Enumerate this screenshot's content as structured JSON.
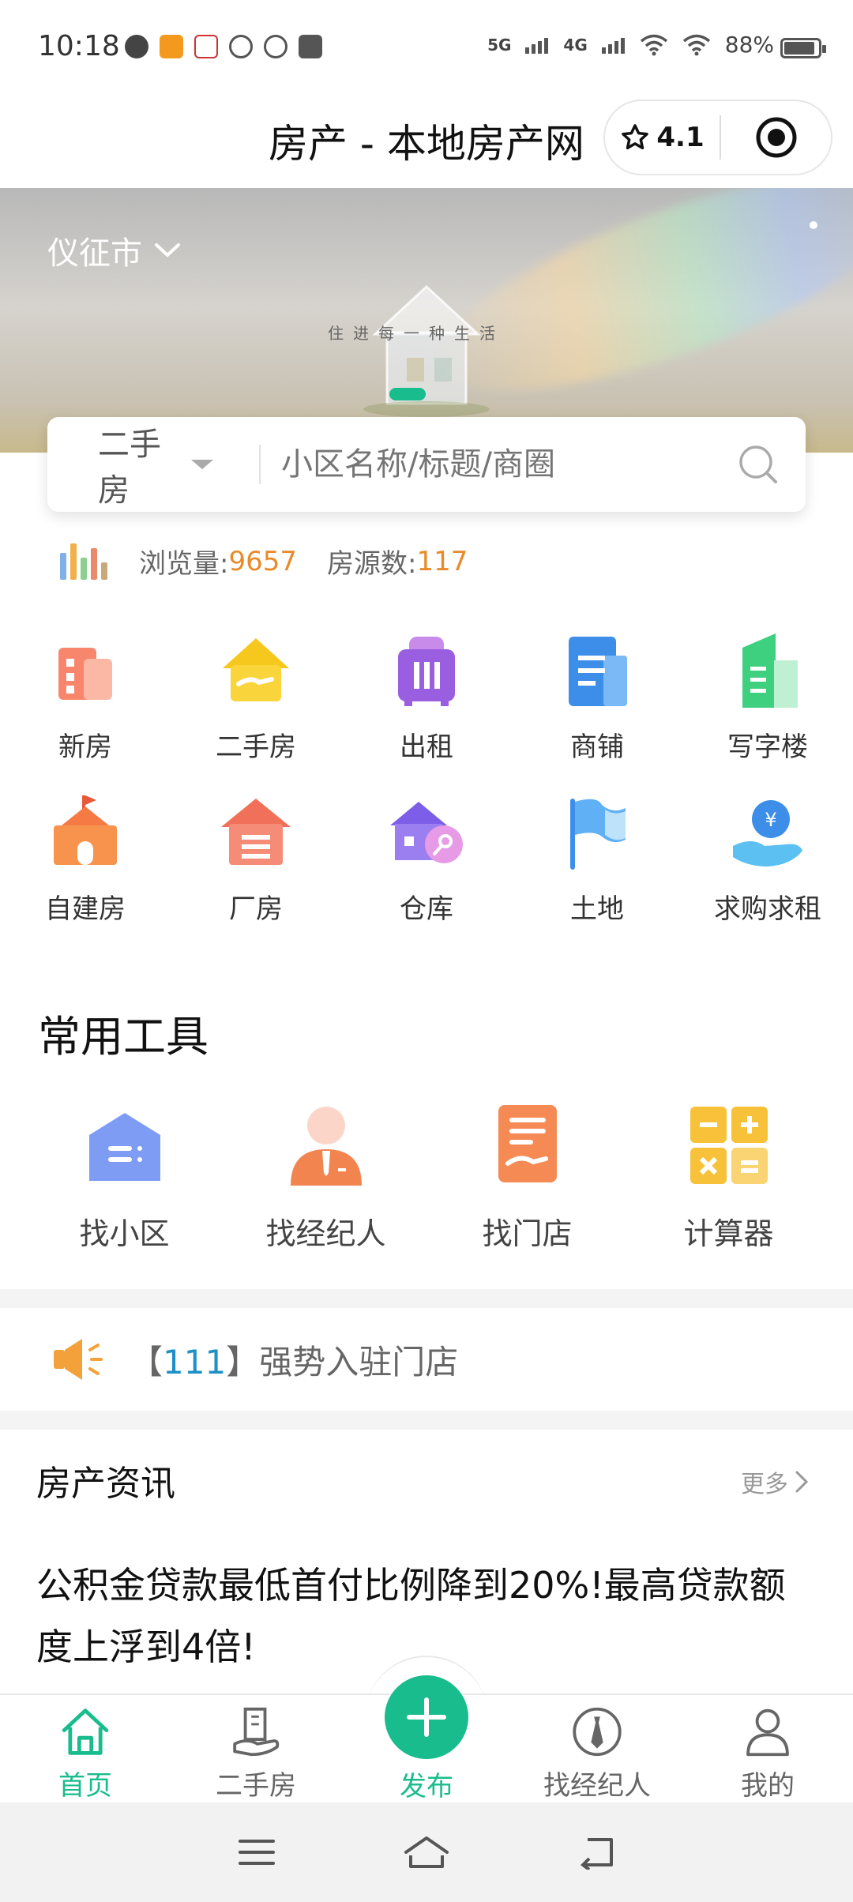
{
  "status_bar": {
    "time": "10:18",
    "app_icons": [
      "message-icon",
      "imou-icon",
      "kfc-icon",
      "app-icon",
      "play-icon",
      "taobao-icon"
    ],
    "signal_5g": "5G",
    "signal_4g": "4G",
    "battery": "88%"
  },
  "title_bar": {
    "title": "房产 - 本地房产网",
    "rating": "4.1"
  },
  "banner": {
    "city": "仪征市",
    "slogan": "住进每一种生活"
  },
  "search": {
    "type": "二手房",
    "placeholder": "小区名称/标题/商圈"
  },
  "stats": {
    "views_label": "浏览量:",
    "views_value": "9657",
    "listings_label": "房源数:",
    "listings_value": "117"
  },
  "categories": [
    {
      "label": "新房",
      "icon": "new-house-icon"
    },
    {
      "label": "二手房",
      "icon": "second-hand-icon"
    },
    {
      "label": "出租",
      "icon": "rent-icon"
    },
    {
      "label": "商铺",
      "icon": "shop-icon"
    },
    {
      "label": "写字楼",
      "icon": "office-icon"
    },
    {
      "label": "自建房",
      "icon": "self-built-icon"
    },
    {
      "label": "厂房",
      "icon": "factory-icon"
    },
    {
      "label": "仓库",
      "icon": "warehouse-icon"
    },
    {
      "label": "土地",
      "icon": "land-icon"
    },
    {
      "label": "求购求租",
      "icon": "wanted-icon"
    }
  ],
  "tools": {
    "title": "常用工具",
    "items": [
      {
        "label": "找小区",
        "icon": "community-icon"
      },
      {
        "label": "找经纪人",
        "icon": "agent-icon"
      },
      {
        "label": "找门店",
        "icon": "store-icon"
      },
      {
        "label": "计算器",
        "icon": "calculator-icon"
      }
    ]
  },
  "notice": {
    "prefix": "【",
    "count": "111",
    "suffix": "】强势入驻门店"
  },
  "news": {
    "title": "房产资讯",
    "more": "更多",
    "headline": "公积金贷款最低首付比例降到20%!最高贷款额度上浮到4倍!"
  },
  "tabbar": {
    "home": "首页",
    "second_hand": "二手房",
    "publish": "发布",
    "agents": "找经纪人",
    "mine": "我的"
  },
  "colors": {
    "accent": "#19bc8c",
    "stat_number": "#e98a2b",
    "notice_highlight": "#1e90c8"
  }
}
